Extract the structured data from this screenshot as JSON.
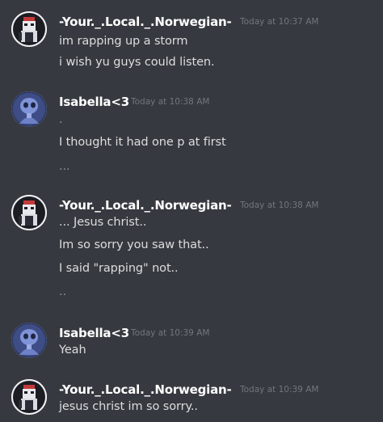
{
  "colors": {
    "background": "#36393f",
    "username": "#ffffff",
    "message_text": "#dcddde",
    "timestamp": "#72767d"
  },
  "messages": [
    {
      "author": "-Your._.Local._.Norwegian-",
      "timestamp": "Today at 10:37 AM",
      "avatar_icon": "dark-figure-avatar-icon",
      "lines": [
        "im rapping up a storm",
        "i wish yu guys could listen."
      ]
    },
    {
      "author": "Isabella<3",
      "timestamp": "Today at 10:38 AM",
      "avatar_icon": "blue-character-avatar-icon",
      "lines": [
        ".",
        "I thought it had one p at first",
        "..."
      ]
    },
    {
      "author": "-Your._.Local._.Norwegian-",
      "timestamp": "Today at 10:38 AM",
      "avatar_icon": "dark-figure-avatar-icon",
      "lines": [
        "... Jesus christ..",
        "Im so sorry you saw that..",
        "I said \"rapping\" not..",
        ".."
      ]
    },
    {
      "author": "Isabella<3",
      "timestamp": "Today at 10:39 AM",
      "avatar_icon": "blue-character-avatar-icon",
      "lines": [
        "Yeah"
      ]
    },
    {
      "author": "-Your._.Local._.Norwegian-",
      "timestamp": "Today at 10:39 AM",
      "avatar_icon": "dark-figure-avatar-icon",
      "lines": [
        "jesus christ im so sorry.."
      ]
    }
  ]
}
